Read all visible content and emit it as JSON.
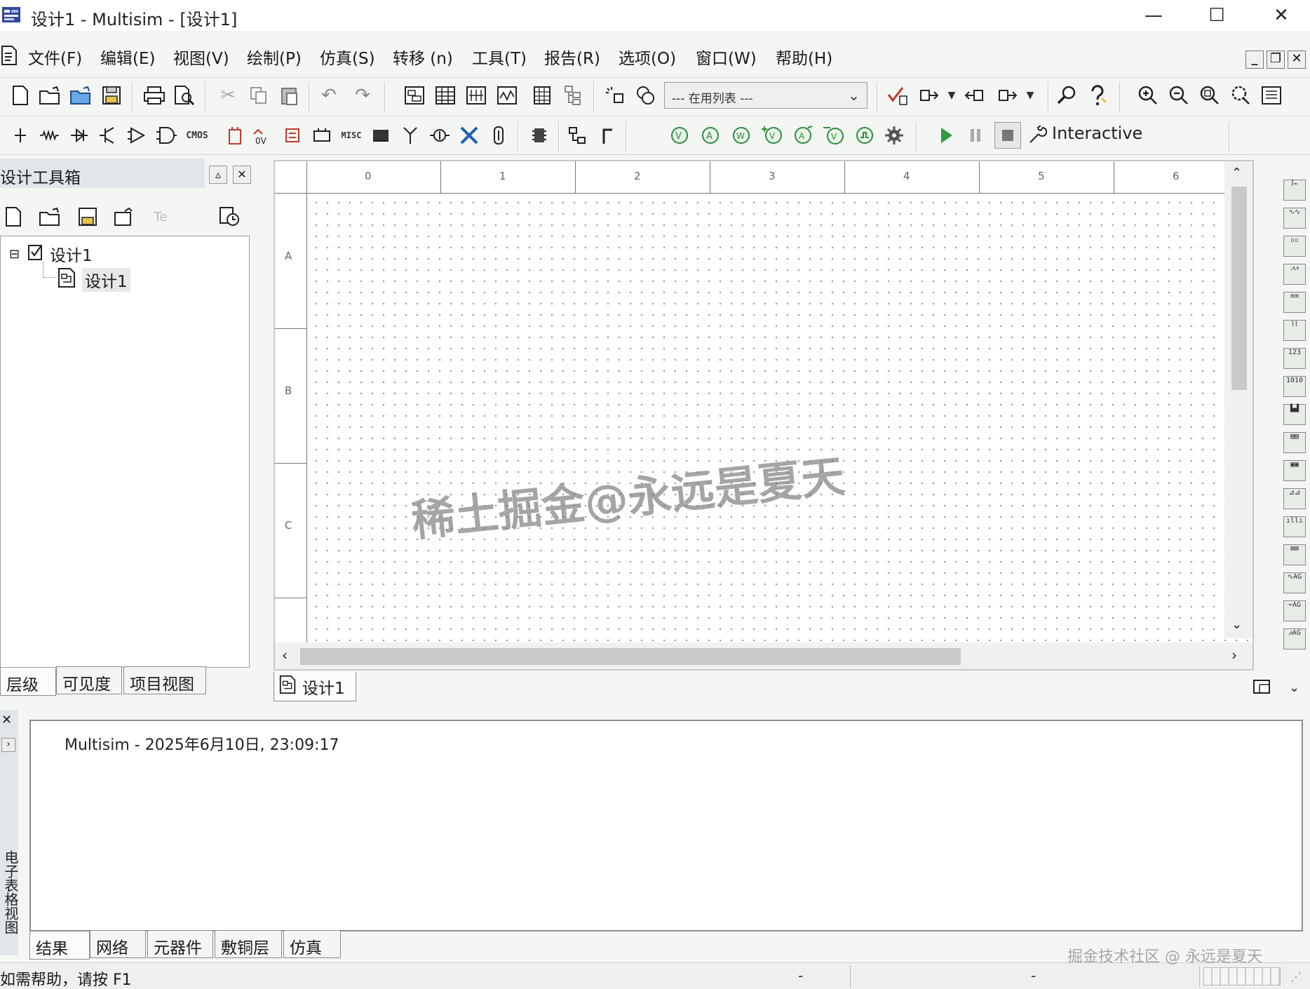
{
  "window": {
    "title": "设计1 - Multisim - [设计1]",
    "minimize": "—",
    "maximize": "☐",
    "close": "✕"
  },
  "menu": {
    "items": [
      "文件(F)",
      "编辑(E)",
      "视图(V)",
      "绘制(P)",
      "仿真(S)",
      "转移 (n)",
      "工具(T)",
      "报告(R)",
      "选项(O)",
      "窗口(W)",
      "帮助(H)"
    ],
    "mdi_minimize": "_",
    "mdi_restore": "❐",
    "mdi_close": "✕"
  },
  "toolbar": {
    "in_use_list": "--- 在用列表 ---",
    "interactive_label": "Interactive"
  },
  "toolbox": {
    "title": "设计工具箱",
    "tree": {
      "root": "设计1",
      "child": "设计1"
    },
    "tabs": [
      "层级",
      "可见度",
      "项目视图"
    ]
  },
  "canvas": {
    "col_labels": [
      "0",
      "1",
      "2",
      "3",
      "4",
      "5",
      "6"
    ],
    "row_labels": [
      "A",
      "B",
      "C"
    ],
    "doc_tab": "设计1"
  },
  "output": {
    "side_label": "电子表格视图",
    "message": "Multisim  -  2025年6月10日, 23:09:17",
    "tabs": [
      "结果",
      "网络",
      "元器件",
      "敷铜层",
      "仿真"
    ]
  },
  "status": {
    "help": "如需帮助，请按 F1",
    "cell1": "-",
    "cell2": "-"
  },
  "watermark": {
    "main": "稀土掘金@永远是夏天",
    "corner": "掘金技术社区 @ 永远是夏天"
  },
  "colors": {
    "accent_green": "#2e8b3c",
    "panel_header": "#e1e6ea"
  }
}
